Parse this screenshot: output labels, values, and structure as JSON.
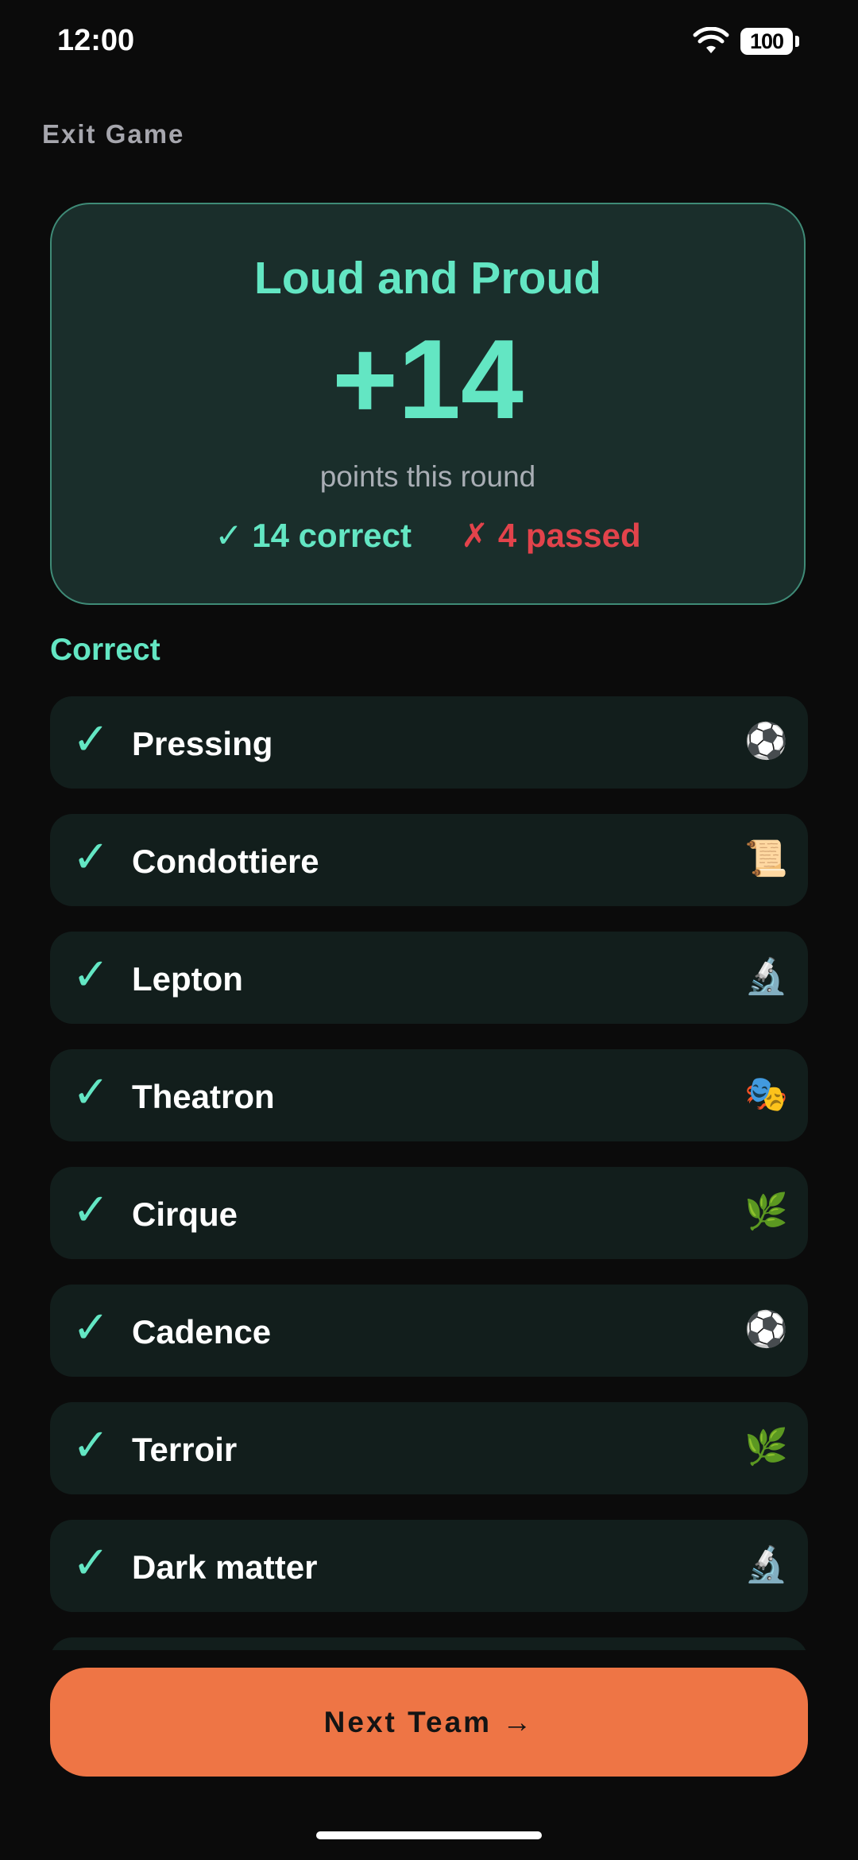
{
  "status_bar": {
    "time": "12:00",
    "battery": "100"
  },
  "header": {
    "exit_label": "Exit Game"
  },
  "score_card": {
    "team_name": "Loud and Proud",
    "points": "+14",
    "points_caption": "points this round",
    "correct_summary": "✓ 14 correct",
    "passed_summary": "✗ 4 passed",
    "colors": {
      "accent": "#63e6c3",
      "passed": "#e2434b"
    }
  },
  "results": {
    "section_label": "Correct",
    "check_glyph": "✓",
    "items": [
      {
        "word": "Pressing",
        "category_icon": "soccer-ball-icon",
        "glyph": "⚽"
      },
      {
        "word": "Condottiere",
        "category_icon": "scroll-icon",
        "glyph": "📜"
      },
      {
        "word": "Lepton",
        "category_icon": "microscope-icon",
        "glyph": "🔬"
      },
      {
        "word": "Theatron",
        "category_icon": "theater-masks-icon",
        "glyph": "🎭"
      },
      {
        "word": "Cirque",
        "category_icon": "herb-icon",
        "glyph": "🌿"
      },
      {
        "word": "Cadence",
        "category_icon": "soccer-ball-icon",
        "glyph": "⚽"
      },
      {
        "word": "Terroir",
        "category_icon": "herb-icon",
        "glyph": "🌿"
      },
      {
        "word": "Dark matter",
        "category_icon": "microscope-icon",
        "glyph": "🔬"
      }
    ]
  },
  "footer": {
    "next_button_label": "Next Team →",
    "button_color": "#ee7545"
  }
}
